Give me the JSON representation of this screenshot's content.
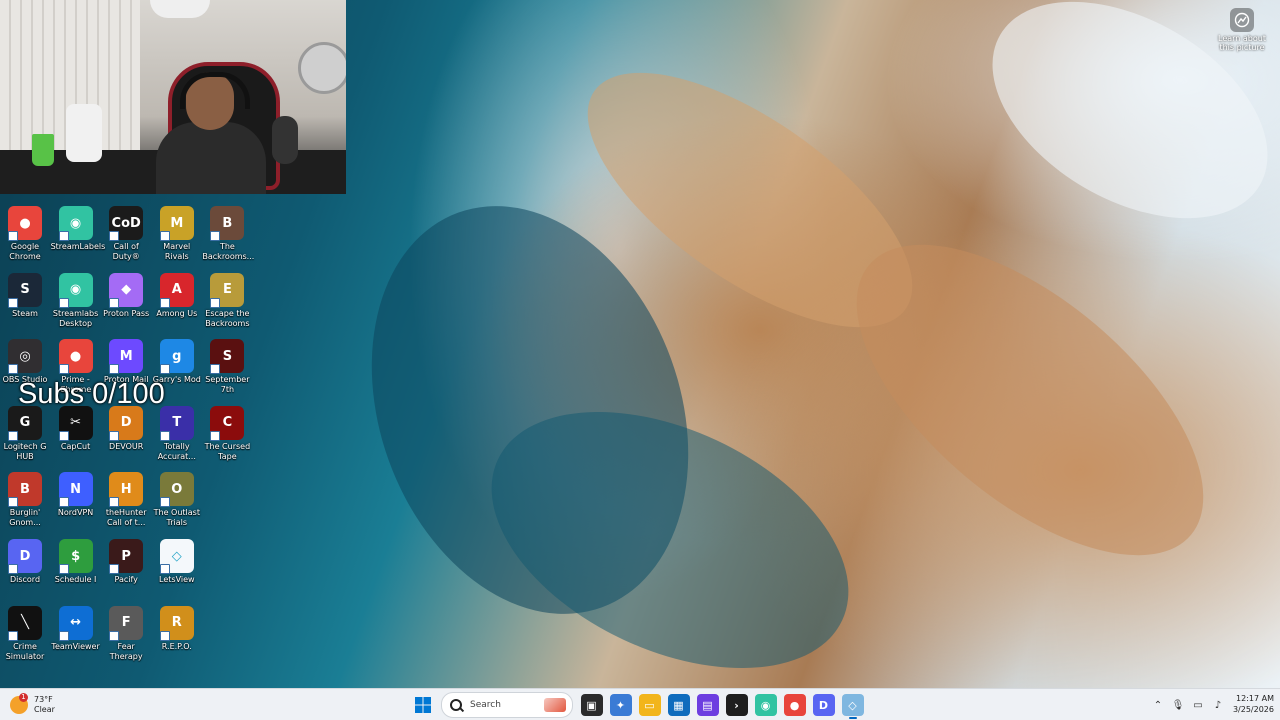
{
  "desktop": {
    "overlay_text": "Subs 0/100",
    "learn_about": "Learn about this picture",
    "icons": [
      {
        "label": "Google Chrome",
        "icon": "chrome-icon",
        "color": "#e8453c",
        "glyph": "●",
        "col": 0,
        "row": 0
      },
      {
        "label": "StreamLabels",
        "icon": "streamlabels-icon",
        "color": "#31c3a2",
        "glyph": "◉",
        "col": 1,
        "row": 0
      },
      {
        "label": "Call of Duty®",
        "icon": "call-of-duty-icon",
        "color": "#1b1b1b",
        "glyph": "CoD",
        "col": 2,
        "row": 0
      },
      {
        "label": "Marvel Rivals",
        "icon": "marvel-rivals-icon",
        "color": "#c9a227",
        "glyph": "M",
        "col": 3,
        "row": 0
      },
      {
        "label": "The Backrooms...",
        "icon": "backrooms-icon",
        "color": "#6b4a3a",
        "glyph": "B",
        "col": 4,
        "row": 0
      },
      {
        "label": "Steam",
        "icon": "steam-icon",
        "color": "#1b2838",
        "glyph": "S",
        "col": 0,
        "row": 1
      },
      {
        "label": "Streamlabs Desktop",
        "icon": "streamlabs-desktop-icon",
        "color": "#31c3a2",
        "glyph": "◉",
        "col": 1,
        "row": 1
      },
      {
        "label": "Proton Pass",
        "icon": "proton-pass-icon",
        "color": "#a46bf5",
        "glyph": "◆",
        "col": 2,
        "row": 1
      },
      {
        "label": "Among Us",
        "icon": "among-us-icon",
        "color": "#d8262c",
        "glyph": "A",
        "col": 3,
        "row": 1
      },
      {
        "label": "Escape the Backrooms",
        "icon": "escape-backrooms-icon",
        "color": "#b89b3a",
        "glyph": "E",
        "col": 4,
        "row": 1
      },
      {
        "label": "OBS Studio",
        "icon": "obs-studio-icon",
        "color": "#302e31",
        "glyph": "◎",
        "col": 0,
        "row": 2
      },
      {
        "label": "Prime - Chrome",
        "icon": "prime-chrome-icon",
        "color": "#e8453c",
        "glyph": "●",
        "col": 1,
        "row": 2
      },
      {
        "label": "Proton Mail",
        "icon": "proton-mail-icon",
        "color": "#6d4aff",
        "glyph": "M",
        "col": 2,
        "row": 2
      },
      {
        "label": "Garry's Mod",
        "icon": "garrys-mod-icon",
        "color": "#1e88e5",
        "glyph": "g",
        "col": 3,
        "row": 2
      },
      {
        "label": "September 7th",
        "icon": "september-7th-icon",
        "color": "#5a1010",
        "glyph": "S",
        "col": 4,
        "row": 2
      },
      {
        "label": "Logitech G HUB",
        "icon": "logitech-ghub-icon",
        "color": "#1a1a1a",
        "glyph": "G",
        "col": 0,
        "row": 3
      },
      {
        "label": "CapCut",
        "icon": "capcut-icon",
        "color": "#111111",
        "glyph": "✂",
        "col": 1,
        "row": 3
      },
      {
        "label": "DEVOUR",
        "icon": "devour-icon",
        "color": "#d87a1a",
        "glyph": "D",
        "col": 2,
        "row": 3
      },
      {
        "label": "Totally Accurat...",
        "icon": "totally-accurate-icon",
        "color": "#3a2fa8",
        "glyph": "T",
        "col": 3,
        "row": 3
      },
      {
        "label": "The Cursed Tape",
        "icon": "cursed-tape-icon",
        "color": "#8b0c0c",
        "glyph": "C",
        "col": 4,
        "row": 3
      },
      {
        "label": "Burglin' Gnom...",
        "icon": "burglin-gnomes-icon",
        "color": "#c0392b",
        "glyph": "B",
        "col": 0,
        "row": 4
      },
      {
        "label": "NordVPN",
        "icon": "nordvpn-icon",
        "color": "#3e5fff",
        "glyph": "N",
        "col": 1,
        "row": 4
      },
      {
        "label": "theHunter Call of t...",
        "icon": "thehunter-icon",
        "color": "#e08b1a",
        "glyph": "H",
        "col": 2,
        "row": 4
      },
      {
        "label": "The Outlast Trials",
        "icon": "outlast-trials-icon",
        "color": "#7a7a3a",
        "glyph": "O",
        "col": 3,
        "row": 4
      },
      {
        "label": "Discord",
        "icon": "discord-icon",
        "color": "#5865f2",
        "glyph": "D",
        "col": 0,
        "row": 5
      },
      {
        "label": "Schedule I",
        "icon": "schedule-i-icon",
        "color": "#2e9d3e",
        "glyph": "$",
        "col": 1,
        "row": 5
      },
      {
        "label": "Pacify",
        "icon": "pacify-icon",
        "color": "#3a1a1a",
        "glyph": "P",
        "col": 2,
        "row": 5
      },
      {
        "label": "LetsView",
        "icon": "letsview-icon",
        "color": "#f4f8fb",
        "glyph": "◇",
        "col": 3,
        "row": 5
      },
      {
        "label": "Crime Simulator",
        "icon": "crime-simulator-icon",
        "color": "#111111",
        "glyph": "╲",
        "col": 0,
        "row": 6
      },
      {
        "label": "TeamViewer",
        "icon": "teamviewer-icon",
        "color": "#0e6ed4",
        "glyph": "↔",
        "col": 1,
        "row": 6
      },
      {
        "label": "Fear Therapy",
        "icon": "fear-therapy-icon",
        "color": "#5a5a5a",
        "glyph": "F",
        "col": 2,
        "row": 6
      },
      {
        "label": "R.E.P.O.",
        "icon": "repo-icon",
        "color": "#d18f1b",
        "glyph": "R",
        "col": 3,
        "row": 6
      }
    ]
  },
  "taskbar": {
    "weather": {
      "temp": "73°F",
      "condition": "Clear",
      "badge": "1"
    },
    "search_placeholder": "Search",
    "apps": [
      {
        "name": "task-view-icon",
        "color": "#2b2b2b",
        "glyph": "▣"
      },
      {
        "name": "copilot-icon",
        "color": "#3a7bd5",
        "glyph": "✦"
      },
      {
        "name": "file-explorer-icon",
        "color": "#f2b51b",
        "glyph": "▭"
      },
      {
        "name": "microsoft-store-icon",
        "color": "#0f6cbd",
        "glyph": "▦"
      },
      {
        "name": "visual-studio-icon",
        "color": "#6d3ee0",
        "glyph": "▤"
      },
      {
        "name": "terminal-icon",
        "color": "#1e1e1e",
        "glyph": "›"
      },
      {
        "name": "streamlabs-icon",
        "color": "#31c3a2",
        "glyph": "◉"
      },
      {
        "name": "chrome-icon",
        "color": "#e8453c",
        "glyph": "●"
      },
      {
        "name": "discord-icon",
        "color": "#5865f2",
        "glyph": "D"
      },
      {
        "name": "letsview-icon",
        "color": "#7fb7e0",
        "glyph": "◇"
      }
    ],
    "tray_icons": [
      "chevron-up-icon",
      "microphone-icon",
      "network-icon",
      "speaker-icon"
    ],
    "time": "12:17 AM",
    "date": "3/25/2026"
  }
}
